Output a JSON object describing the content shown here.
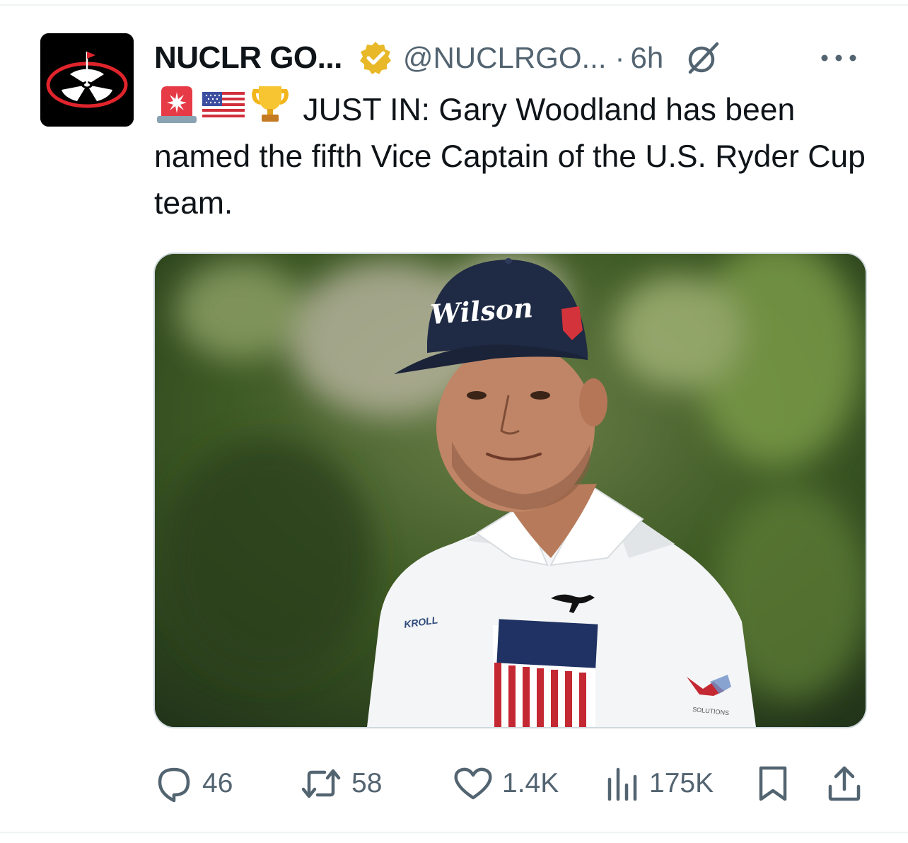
{
  "tweet": {
    "display_name": "NUCLR GO...",
    "handle": "@NUCLRGO...",
    "separator": "·",
    "time": "6h",
    "text": "JUST IN: Gary Woodland has been named the fifth Vice Captain of the U.S. Ryder Cup team.",
    "emojis": [
      "rotating-light-icon",
      "us-flag-icon",
      "trophy-icon"
    ],
    "image": {
      "cap_brand": "Wilson",
      "shirt_brand": "KROLL",
      "sleeve_brand": "SOLUTIONS"
    }
  },
  "actions": {
    "replies": "46",
    "reposts": "58",
    "likes": "1.4K",
    "views": "175K"
  },
  "colors": {
    "text_primary": "#0f1419",
    "text_secondary": "#536471",
    "verified_gold": "#e8b829",
    "divider": "#eff3f4"
  }
}
